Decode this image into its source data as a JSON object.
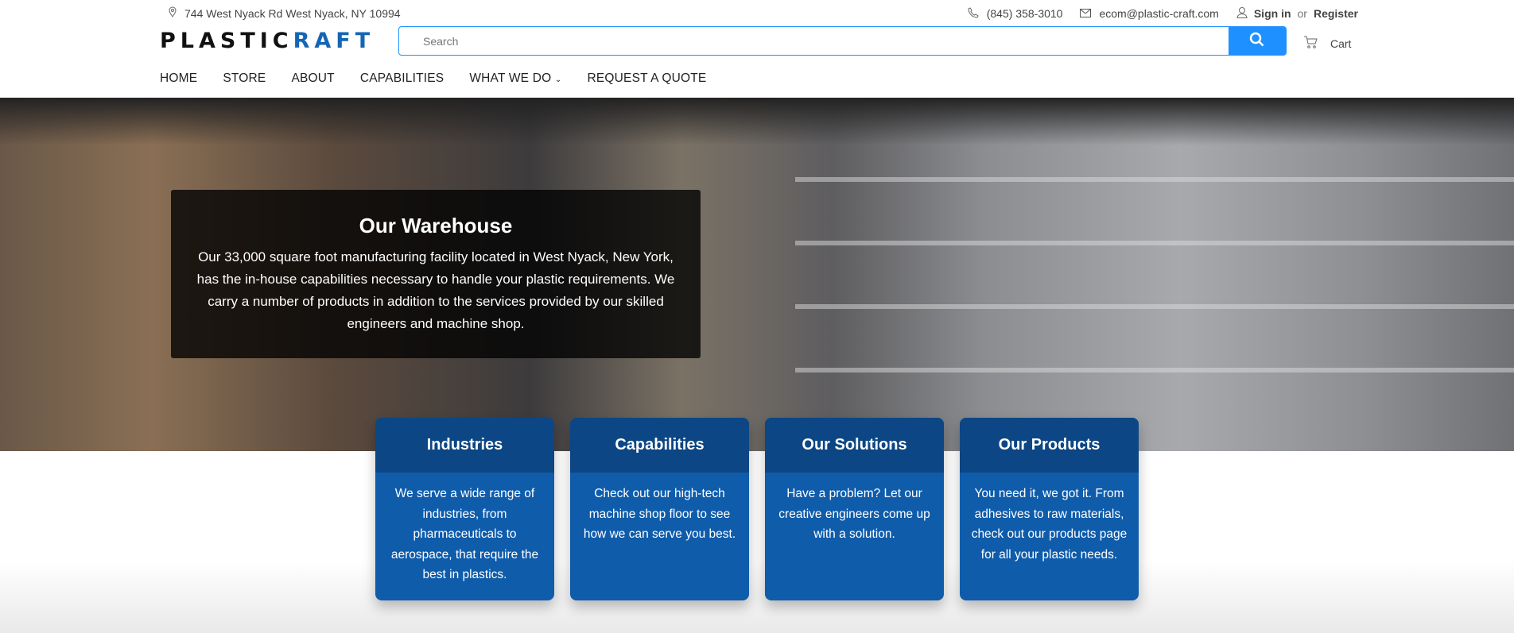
{
  "topbar": {
    "address": "744 West Nyack Rd West Nyack, NY 10994",
    "phone": "(845) 358-3010",
    "email": "ecom@plastic-craft.com",
    "sign_in": "Sign in",
    "or": "or",
    "register": "Register"
  },
  "logo": {
    "part1": "PLASTIC",
    "part2": "RAFT"
  },
  "search": {
    "placeholder": "Search"
  },
  "cart": {
    "label": "Cart"
  },
  "nav": [
    "HOME",
    "STORE",
    "ABOUT",
    "CAPABILITIES",
    "WHAT WE DO",
    "REQUEST A QUOTE"
  ],
  "hero": {
    "title": "Our Warehouse",
    "text": "Our 33,000 square foot manufacturing facility located in West Nyack, New York, has the in-house capabilities necessary to handle your plastic requirements. We carry a number of products in addition to the services provided by our skilled engineers and machine shop."
  },
  "cards": [
    {
      "title": "Industries",
      "text": "We serve a wide range of industries, from pharmaceuticals to aerospace, that require the best in plastics."
    },
    {
      "title": "Capabilities",
      "text": "Check out our high-tech machine shop floor to see how we can serve you best."
    },
    {
      "title": "Our Solutions",
      "text": "Have a problem? Let our creative engineers come up with a solution."
    },
    {
      "title": "Our Products",
      "text": "You need it, we got it. From adhesives to raw materials, check out our products page for all your plastic needs."
    }
  ],
  "colors": {
    "accent": "#1e90ff",
    "card": "#0f5cab",
    "card_header": "#0c4684"
  }
}
